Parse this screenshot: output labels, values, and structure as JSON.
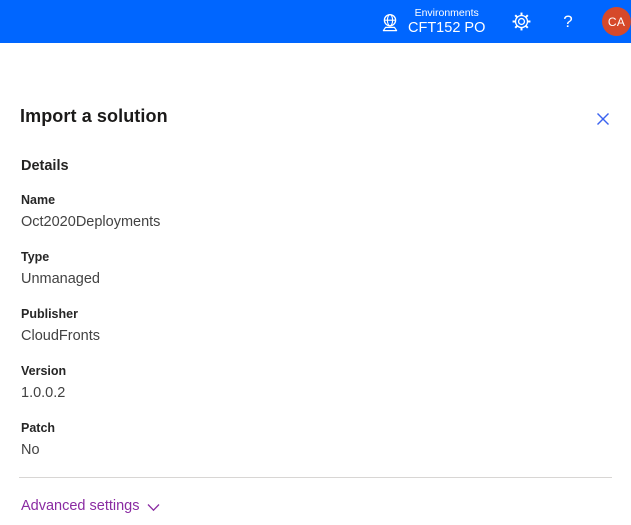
{
  "topbar": {
    "environment": {
      "label": "Environments",
      "name": "CFT152 PO"
    },
    "help_glyph": "?",
    "avatar_initials": "CA"
  },
  "panel": {
    "title": "Import a solution",
    "section_title": "Details",
    "fields": [
      {
        "label": "Name",
        "value": "Oct2020Deployments"
      },
      {
        "label": "Type",
        "value": "Unmanaged"
      },
      {
        "label": "Publisher",
        "value": "CloudFronts"
      },
      {
        "label": "Version",
        "value": "1.0.0.2"
      },
      {
        "label": "Patch",
        "value": "No"
      }
    ],
    "advanced_settings_label": "Advanced settings"
  },
  "colors": {
    "header_bg": "#0066FF",
    "avatar_bg": "#D6492A",
    "close_icon_blue": "#3B63F0",
    "advanced_purple": "#8A2BA2",
    "divider_gray": "#D8D6D4"
  },
  "icons": {
    "globe": "environments-globe-icon",
    "gear": "settings-gear-icon",
    "help": "help-question-icon",
    "close": "close-x-icon",
    "chevron": "chevron-down-icon"
  }
}
